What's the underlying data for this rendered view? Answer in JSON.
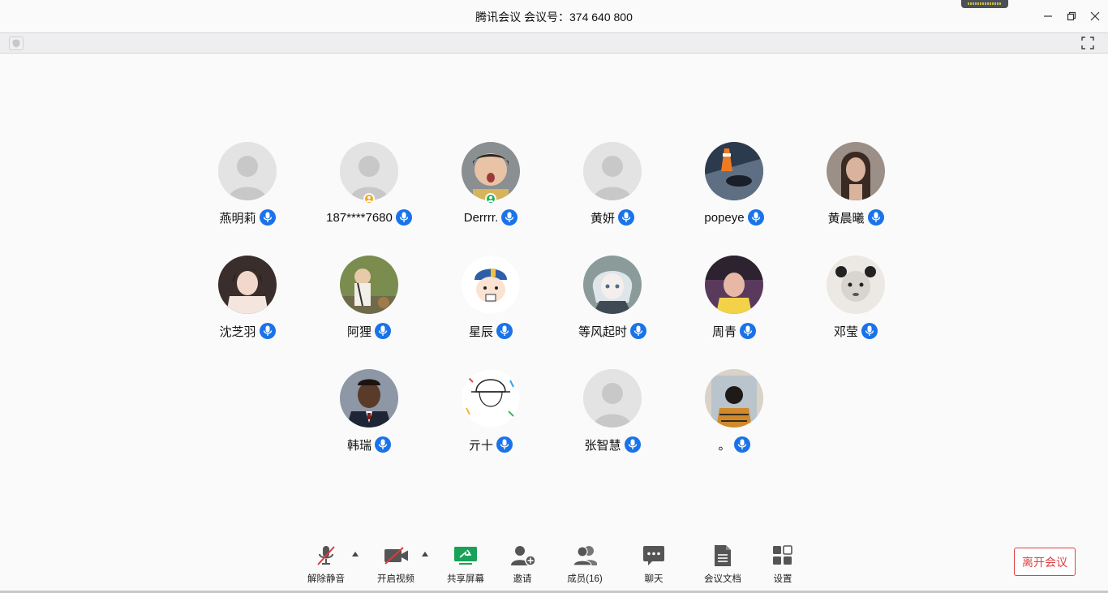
{
  "window": {
    "title": "腾讯会议 会议号：374 640 800"
  },
  "participants": [
    {
      "name": "燕明莉",
      "avatar": "default-silhouette"
    },
    {
      "name": "187****7680",
      "avatar": "default-silhouette",
      "role_badge": "host",
      "role_color": "#f5a623"
    },
    {
      "name": "Derrrr.",
      "avatar": "photo-child",
      "role_badge": "co-host",
      "role_color": "#22b35e"
    },
    {
      "name": "黄妍",
      "avatar": "default-silhouette"
    },
    {
      "name": "popeye",
      "avatar": "photo-street"
    },
    {
      "name": "黄晨曦",
      "avatar": "photo-woman"
    },
    {
      "name": "沈芝羽",
      "avatar": "photo-girl"
    },
    {
      "name": "阿狸",
      "avatar": "photo-toddler"
    },
    {
      "name": "星辰",
      "avatar": "cartoon-sticker"
    },
    {
      "name": "等风起时",
      "avatar": "anime-character"
    },
    {
      "name": "周青",
      "avatar": "photo-kid-car"
    },
    {
      "name": "邓莹",
      "avatar": "photo-baby-bw"
    },
    {
      "name": "韩瑞",
      "avatar": "photo-boy-suit"
    },
    {
      "name": "亓十",
      "avatar": "doodle-drawing"
    },
    {
      "name": "张智慧",
      "avatar": "default-silhouette"
    },
    {
      "name": "。",
      "avatar": "photo-back-view"
    }
  ],
  "toolbar": {
    "mute": "解除静音",
    "video": "开启视频",
    "share": "共享屏幕",
    "invite": "邀请",
    "members": "成员(16)",
    "chat": "聊天",
    "docs": "会议文档",
    "settings": "设置",
    "leave": "离开会议"
  },
  "colors": {
    "accent_blue": "#1a73e8",
    "share_green": "#1aa158",
    "leave_red": "#e04040",
    "mic_muted_red": "#e03a3a"
  }
}
